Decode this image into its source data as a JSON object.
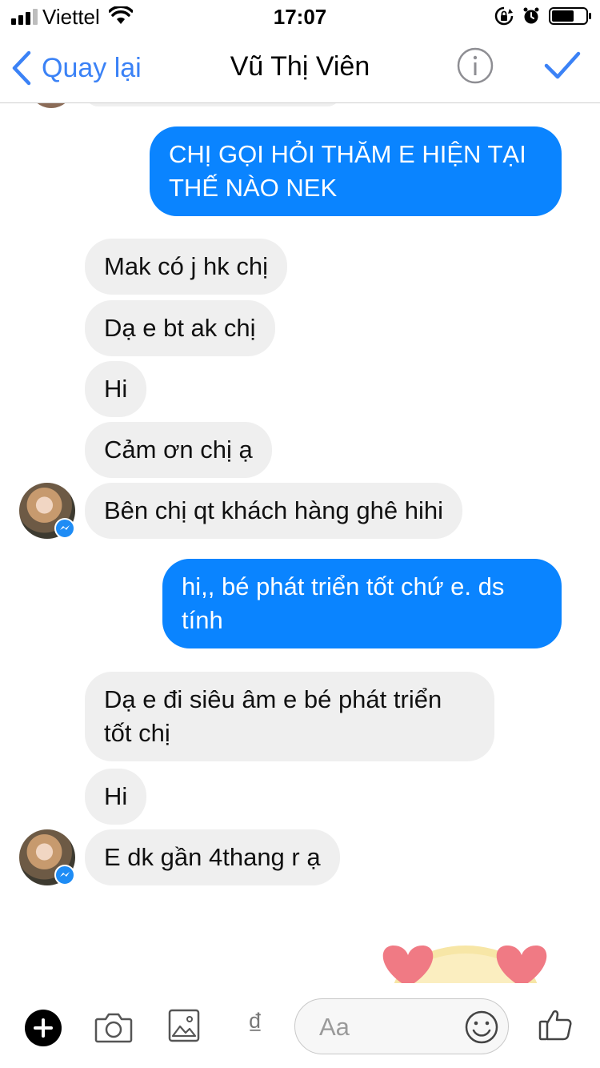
{
  "status_bar": {
    "carrier": "Viettel",
    "time": "17:07"
  },
  "nav": {
    "back_label": "Quay lại",
    "title": "Vũ Thị Viên"
  },
  "messages": [
    {
      "side": "out",
      "text": "CHỊ GỌI HỎI THĂM E HIỆN TẠI THẾ NÀO NEK"
    },
    {
      "side": "in",
      "text": "Mak có j hk chị"
    },
    {
      "side": "in",
      "text": "Dạ e bt ak chị"
    },
    {
      "side": "in",
      "text": "Hi"
    },
    {
      "side": "in",
      "text": "Cảm ơn chị ạ"
    },
    {
      "side": "in",
      "text": "Bên chị qt khách hàng ghê hihi"
    },
    {
      "side": "out",
      "text": "hi,, bé phát triển tốt chứ e. ds tính"
    },
    {
      "side": "in",
      "text": "Dạ e đi siêu âm e bé phát triển tốt chị"
    },
    {
      "side": "in",
      "text": "Hi"
    },
    {
      "side": "in",
      "text": "E dk gần 4thang r ạ"
    }
  ],
  "composer": {
    "placeholder": "Aa",
    "currency_symbol": "₫"
  },
  "colors": {
    "accent": "#3b82f6",
    "outgoing_bubble": "#0a84ff",
    "incoming_bubble": "#efefef",
    "messenger_badge": "#1e8cf5"
  },
  "icons": [
    "back-chevron-icon",
    "info-icon",
    "checkmark-icon",
    "plus-icon",
    "camera-icon",
    "photo-icon",
    "smiley-icon",
    "thumbs-up-icon",
    "messenger-badge-icon",
    "heart-sticker-icon"
  ]
}
